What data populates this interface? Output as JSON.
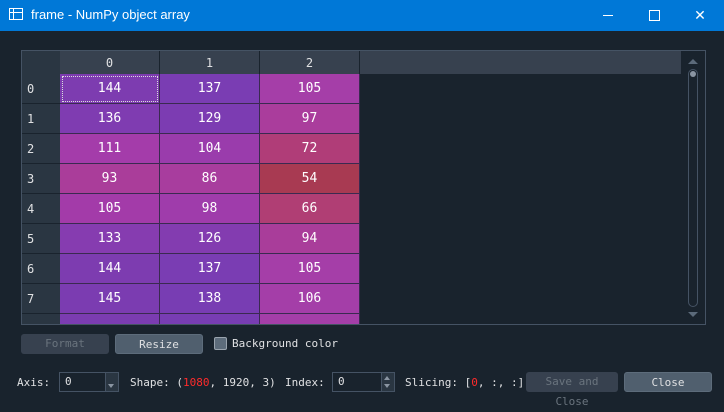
{
  "window": {
    "title": "frame - NumPy object array",
    "controls": [
      "minimize-icon",
      "maximize-icon",
      "close-icon"
    ]
  },
  "table": {
    "columns": [
      "0",
      "1",
      "2"
    ],
    "rows": [
      "0",
      "1",
      "2",
      "3",
      "4",
      "5",
      "6",
      "7"
    ],
    "cells": [
      [
        "144",
        "137",
        "105"
      ],
      [
        "136",
        "129",
        "97"
      ],
      [
        "111",
        "104",
        "72"
      ],
      [
        "93",
        "86",
        "54"
      ],
      [
        "105",
        "98",
        "66"
      ],
      [
        "133",
        "126",
        "94"
      ],
      [
        "144",
        "137",
        "105"
      ],
      [
        "145",
        "138",
        "106"
      ]
    ],
    "cell_colors": [
      [
        "#7d3cb0",
        "#7a3db3",
        "#a53ea8"
      ],
      [
        "#7f3cb1",
        "#7c3cb2",
        "#aa3d9c"
      ],
      [
        "#a43caa",
        "#9a3cac",
        "#b03d78"
      ],
      [
        "#aa3d9a",
        "#a83d9e",
        "#a83a52"
      ],
      [
        "#a33ba9",
        "#9f3cab",
        "#b03e74"
      ],
      [
        "#863cb0",
        "#833cb0",
        "#a93d9a"
      ],
      [
        "#7d3cb0",
        "#7a3db3",
        "#a53ea8"
      ],
      [
        "#7b3cb1",
        "#783db3",
        "#a43ea8"
      ]
    ],
    "selected_cell": "0,0"
  },
  "controls": {
    "format_label": "Format",
    "resize_label": "Resize",
    "background_color_label": "Background color",
    "background_color_checked": true
  },
  "footer": {
    "axis_label": "Axis:",
    "axis_value": "0",
    "shape_label": "Shape:",
    "shape_open": "(",
    "shape_highlight": "1080",
    "shape_rest": ", 1920, 3)",
    "index_label": "Index:",
    "index_value": "0",
    "slicing_label": "Slicing:",
    "slicing_open": "[",
    "slicing_highlight": "0",
    "slicing_rest": ", :, :]",
    "save_close_label": "Save and Close",
    "close_label": "Close"
  }
}
